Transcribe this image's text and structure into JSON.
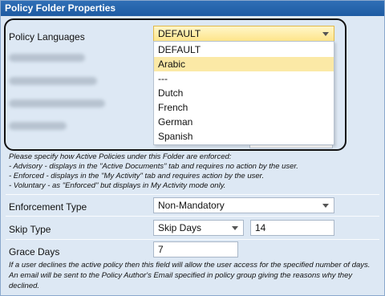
{
  "window": {
    "title": "Policy Folder Properties"
  },
  "policy_languages": {
    "label": "Policy Languages",
    "selected": "DEFAULT",
    "options": [
      "DEFAULT",
      "Arabic",
      "---",
      "Dutch",
      "French",
      "German",
      "Spanish"
    ],
    "highlighted": "Arabic"
  },
  "enforcement_help": {
    "line1": "Please specify how Active Policies under this Folder are enforced:",
    "line2": "- Advisory - displays in the \"Active Documents\" tab and requires no action by the user.",
    "line3": "- Enforced - displays in the \"My Activity\" tab and requires action by the user.",
    "line4": "- Voluntary - as \"Enforced\" but displays in My Activity mode only."
  },
  "enforcement_type": {
    "label": "Enforcement Type",
    "value": "Non-Mandatory"
  },
  "skip_type": {
    "label": "Skip Type",
    "value": "Skip Days",
    "count": "14"
  },
  "grace_days": {
    "label": "Grace Days",
    "value": "7"
  },
  "grace_help": {
    "line1": "If a user declines the active policy then this field will allow the user access for the specified number of days.",
    "line2": "An email will be sent to the Policy Author's Email specified in policy group giving the reasons why they",
    "line3": "declined."
  },
  "colors": {
    "titlebar": "#1e5ba2",
    "highlight": "#fbe9a6",
    "background": "#dde8f4"
  }
}
